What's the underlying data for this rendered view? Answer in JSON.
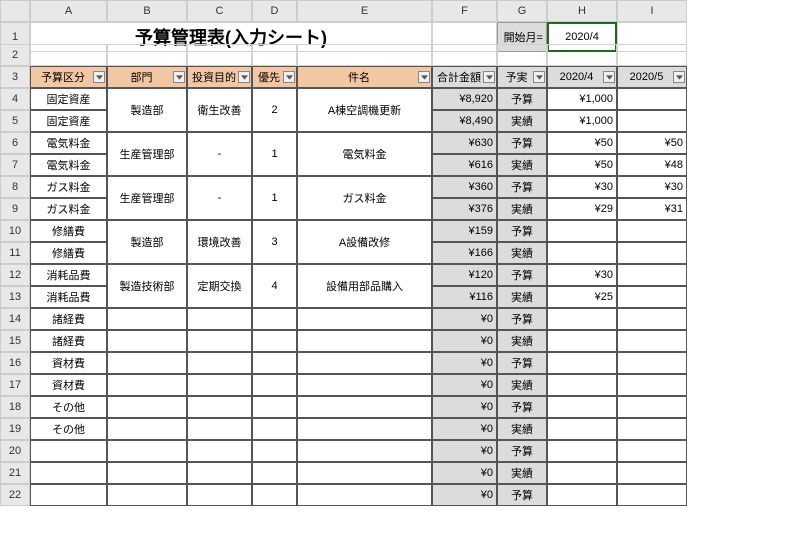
{
  "columns": [
    "A",
    "B",
    "C",
    "D",
    "E",
    "F",
    "G",
    "H",
    "I"
  ],
  "rowNumbers": [
    1,
    2,
    3,
    4,
    5,
    6,
    7,
    8,
    9,
    10,
    11,
    12,
    13,
    14,
    15,
    16,
    17,
    18,
    19,
    20,
    21,
    22
  ],
  "title": "予算管理表(入力シート)",
  "startLabel": "開始月=",
  "startValue": "2020/4",
  "headers": {
    "A": "予算区分",
    "B": "部門",
    "C": "投資目的",
    "D": "優先",
    "E": "件名",
    "F": "合計金額",
    "G": "予実",
    "H": "2020/4",
    "I": "2020/5"
  },
  "rows": [
    {
      "a": "固定資産",
      "b": "製造部",
      "c": "衛生改善",
      "d": "2",
      "e": "A棟空調機更新",
      "f": "¥8,920",
      "g": "予算",
      "h": "¥1,000",
      "i": ""
    },
    {
      "a": "固定資産",
      "b": "",
      "c": "",
      "d": "",
      "e": "",
      "f": "¥8,490",
      "g": "実績",
      "h": "¥1,000",
      "i": ""
    },
    {
      "a": "電気料金",
      "b": "生産管理部",
      "c": "-",
      "d": "1",
      "e": "電気料金",
      "f": "¥630",
      "g": "予算",
      "h": "¥50",
      "i": "¥50"
    },
    {
      "a": "電気料金",
      "b": "",
      "c": "",
      "d": "",
      "e": "",
      "f": "¥616",
      "g": "実績",
      "h": "¥50",
      "i": "¥48"
    },
    {
      "a": "ガス料金",
      "b": "生産管理部",
      "c": "-",
      "d": "1",
      "e": "ガス料金",
      "f": "¥360",
      "g": "予算",
      "h": "¥30",
      "i": "¥30"
    },
    {
      "a": "ガス料金",
      "b": "",
      "c": "",
      "d": "",
      "e": "",
      "f": "¥376",
      "g": "実績",
      "h": "¥29",
      "i": "¥31"
    },
    {
      "a": "修繕費",
      "b": "製造部",
      "c": "環境改善",
      "d": "3",
      "e": "A設備改修",
      "f": "¥159",
      "g": "予算",
      "h": "",
      "i": ""
    },
    {
      "a": "修繕費",
      "b": "",
      "c": "",
      "d": "",
      "e": "",
      "f": "¥166",
      "g": "実績",
      "h": "",
      "i": ""
    },
    {
      "a": "消耗品費",
      "b": "製造技術部",
      "c": "定期交換",
      "d": "4",
      "e": "設備用部品購入",
      "f": "¥120",
      "g": "予算",
      "h": "¥30",
      "i": ""
    },
    {
      "a": "消耗品費",
      "b": "",
      "c": "",
      "d": "",
      "e": "",
      "f": "¥116",
      "g": "実績",
      "h": "¥25",
      "i": ""
    },
    {
      "a": "諸経費",
      "b": "",
      "c": "",
      "d": "",
      "e": "",
      "f": "¥0",
      "g": "予算",
      "h": "",
      "i": ""
    },
    {
      "a": "諸経費",
      "b": "",
      "c": "",
      "d": "",
      "e": "",
      "f": "¥0",
      "g": "実績",
      "h": "",
      "i": ""
    },
    {
      "a": "資材費",
      "b": "",
      "c": "",
      "d": "",
      "e": "",
      "f": "¥0",
      "g": "予算",
      "h": "",
      "i": ""
    },
    {
      "a": "資材費",
      "b": "",
      "c": "",
      "d": "",
      "e": "",
      "f": "¥0",
      "g": "実績",
      "h": "",
      "i": ""
    },
    {
      "a": "その他",
      "b": "",
      "c": "",
      "d": "",
      "e": "",
      "f": "¥0",
      "g": "予算",
      "h": "",
      "i": ""
    },
    {
      "a": "その他",
      "b": "",
      "c": "",
      "d": "",
      "e": "",
      "f": "¥0",
      "g": "実績",
      "h": "",
      "i": ""
    },
    {
      "a": "",
      "b": "",
      "c": "",
      "d": "",
      "e": "",
      "f": "¥0",
      "g": "予算",
      "h": "",
      "i": ""
    },
    {
      "a": "",
      "b": "",
      "c": "",
      "d": "",
      "e": "",
      "f": "¥0",
      "g": "実績",
      "h": "",
      "i": ""
    },
    {
      "a": "",
      "b": "",
      "c": "",
      "d": "",
      "e": "",
      "f": "¥0",
      "g": "予算",
      "h": "",
      "i": ""
    }
  ],
  "mergePairs": [
    0,
    2,
    4,
    6,
    8
  ]
}
